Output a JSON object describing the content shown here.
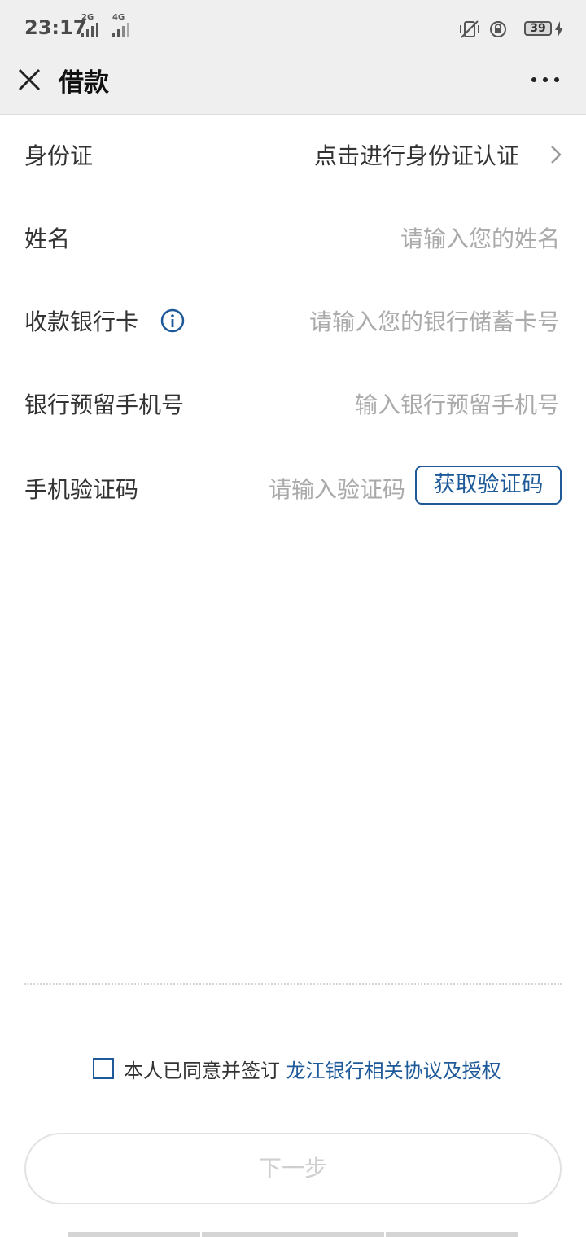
{
  "status_bar": {
    "time": "23:17",
    "sim1_label": "2G",
    "sim2_label": "4G",
    "battery": "39"
  },
  "nav": {
    "title": "借款",
    "close_icon": "close-icon",
    "more_icon": "more-icon"
  },
  "form": {
    "id_card": {
      "label": "身份证",
      "value": "点击进行身份证认证"
    },
    "name": {
      "label": "姓名",
      "placeholder": "请输入您的姓名"
    },
    "bank_card": {
      "label": "收款银行卡",
      "placeholder": "请输入您的银行储蓄卡号"
    },
    "bank_phone": {
      "label": "银行预留手机号",
      "placeholder": "输入银行预留手机号"
    },
    "sms_code": {
      "label": "手机验证码",
      "placeholder": "请输入验证码",
      "button": "获取验证码"
    }
  },
  "agreement": {
    "text": "本人已同意并签订",
    "link": "龙江银行相关协议及授权",
    "checked": false
  },
  "next_button": "下一步",
  "colors": {
    "accent": "#1e5a9a",
    "placeholder": "#aaaaaa",
    "disabled": "#cfcfcf"
  }
}
